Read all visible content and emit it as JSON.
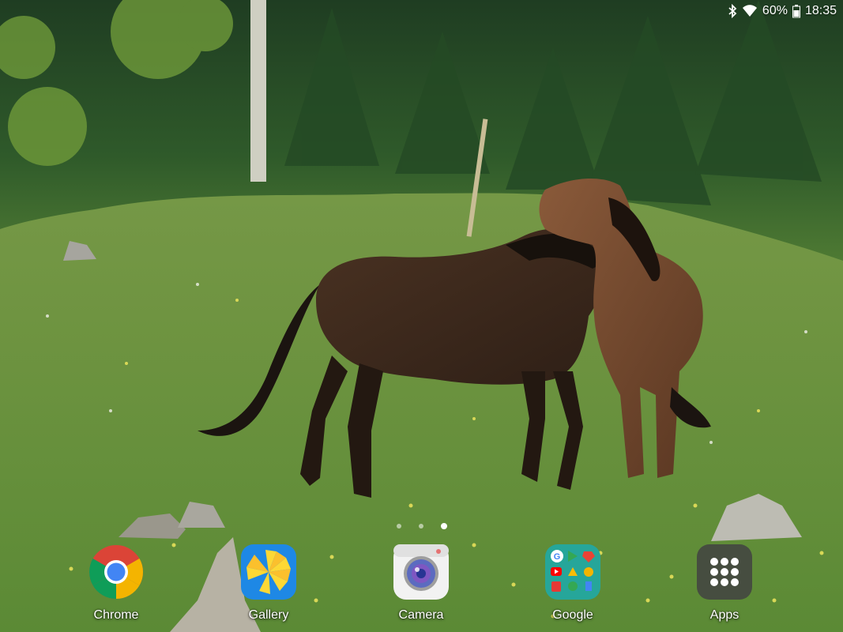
{
  "status_bar": {
    "battery": "60%",
    "time": "18:35",
    "icons": [
      "bluetooth-icon",
      "wifi-icon",
      "battery-icon"
    ]
  },
  "home_pages": {
    "count": 3,
    "active_index": 2
  },
  "dock": {
    "apps": [
      {
        "label": "Chrome",
        "icon": "chrome-icon"
      },
      {
        "label": "Gallery",
        "icon": "gallery-icon"
      },
      {
        "label": "Camera",
        "icon": "camera-icon"
      },
      {
        "label": "Google",
        "icon": "google-folder-icon"
      },
      {
        "label": "Apps",
        "icon": "apps-grid-icon"
      }
    ]
  },
  "colors": {
    "chrome_red": "#DB4437",
    "chrome_yellow": "#F4B400",
    "chrome_green": "#0F9D58",
    "chrome_blue": "#4285F4",
    "gallery_bg": "#1E88E5",
    "gallery_flower": "#FDD835",
    "google_folder_bg": "#26A69A",
    "apps_bg": "#424242"
  }
}
